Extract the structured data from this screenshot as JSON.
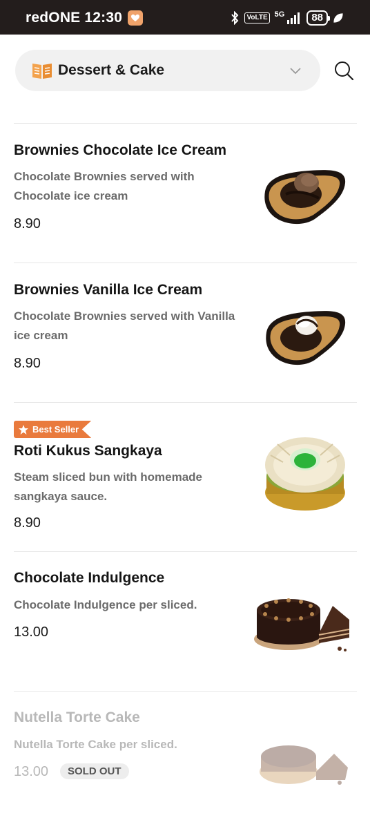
{
  "status_bar": {
    "carrier_time": "redONE 12:30",
    "network": "VoLTE",
    "signal": "5G",
    "battery": "88"
  },
  "header": {
    "category": "Dessert & Cake"
  },
  "items": [
    {
      "name": "Brownies Chocolate Ice Cream",
      "description": "Chocolate Brownies served with Chocolate ice cream",
      "price": "8.90"
    },
    {
      "name": "Brownies Vanilla Ice Cream",
      "description": "Chocolate Brownies served with Vanilla ice cream",
      "price": "8.90"
    },
    {
      "badge": "Best Seller",
      "name": "Roti Kukus Sangkaya",
      "description": "Steam sliced bun with homemade sangkaya sauce.",
      "price": "8.90"
    },
    {
      "name": "Chocolate Indulgence",
      "description": "Chocolate Indulgence per sliced.",
      "price": "13.00"
    },
    {
      "name": "Nutella Torte Cake",
      "description": "Nutella Torte Cake per sliced.",
      "price": "13.00",
      "status": "SOLD OUT"
    }
  ],
  "colors": {
    "status_bar": "#231d1c",
    "badge": "#e97a3d",
    "divider": "#e6e6e6"
  }
}
